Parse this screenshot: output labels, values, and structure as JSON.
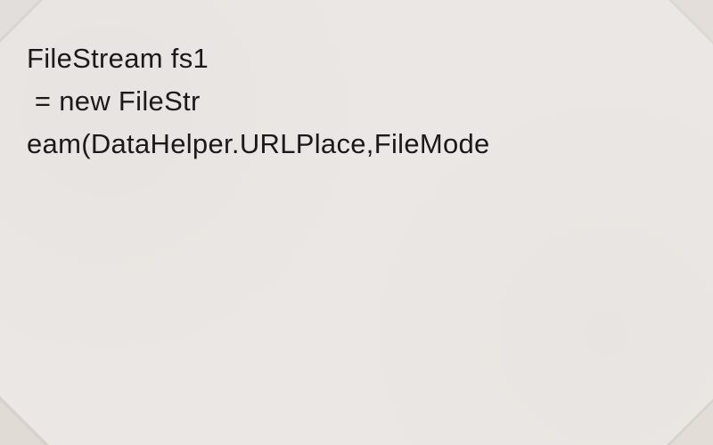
{
  "code": {
    "line1": "FileStream fs1",
    "line2": " = new FileStr",
    "line3": "eam(DataHelper.URLPlace,FileMode"
  }
}
